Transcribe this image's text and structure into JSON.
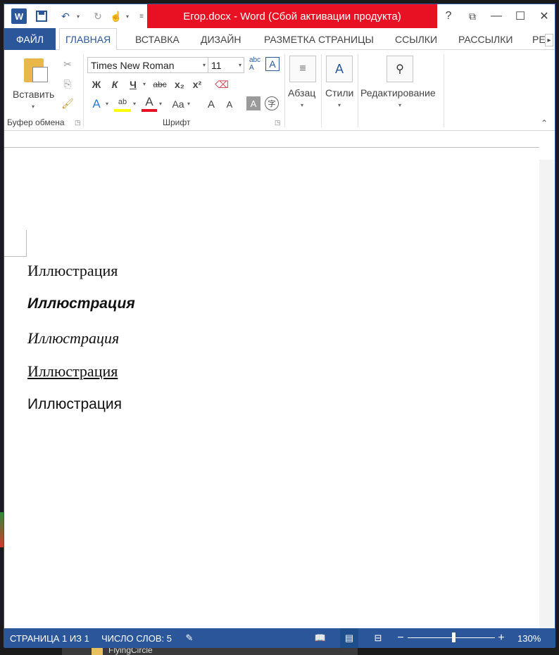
{
  "titlebar": {
    "title": "Егор.docx -  Word (Сбой активации продукта)",
    "help": "?",
    "restore_ribbon": "⧉",
    "minimize": "—",
    "maximize": "☐",
    "close": "✕",
    "title_bg": "#e81123"
  },
  "tabs": [
    {
      "label": "ФАЙЛ"
    },
    {
      "label": "ГЛАВНАЯ"
    },
    {
      "label": "ВСТАВКА"
    },
    {
      "label": "ДИЗАЙН"
    },
    {
      "label": "РАЗМЕТКА СТРАНИЦЫ"
    },
    {
      "label": "ССЫЛКИ"
    },
    {
      "label": "РАССЫЛКИ"
    },
    {
      "label": "РЕ"
    }
  ],
  "ribbon": {
    "clipboard": {
      "paste_label": "Вставить",
      "group_label": "Буфер обмена"
    },
    "font": {
      "font_name": "Times New Roman",
      "font_size": "11",
      "bold": "Ж",
      "italic": "К",
      "underline": "Ч",
      "strike": "abc",
      "subscript": "x₂",
      "superscript": "x²",
      "case": "Aa",
      "grow": "A",
      "shrink": "A",
      "group_label": "Шрифт"
    },
    "paragraph": {
      "label": "Абзац"
    },
    "styles": {
      "label": "Стили"
    },
    "editing": {
      "label": "Редактирование"
    }
  },
  "document": {
    "paragraphs": [
      "Иллюстрация",
      "Иллюстрация",
      "Иллюстрация",
      "Иллюстрация",
      "Иллюстрация"
    ]
  },
  "statusbar": {
    "page": "СТРАНИЦА 1 ИЗ 1",
    "words": "ЧИСЛО СЛОВ: 5",
    "zoom": "130%",
    "bg": "#2b579a"
  },
  "background": {
    "folder_label": "FlyingCircle"
  }
}
